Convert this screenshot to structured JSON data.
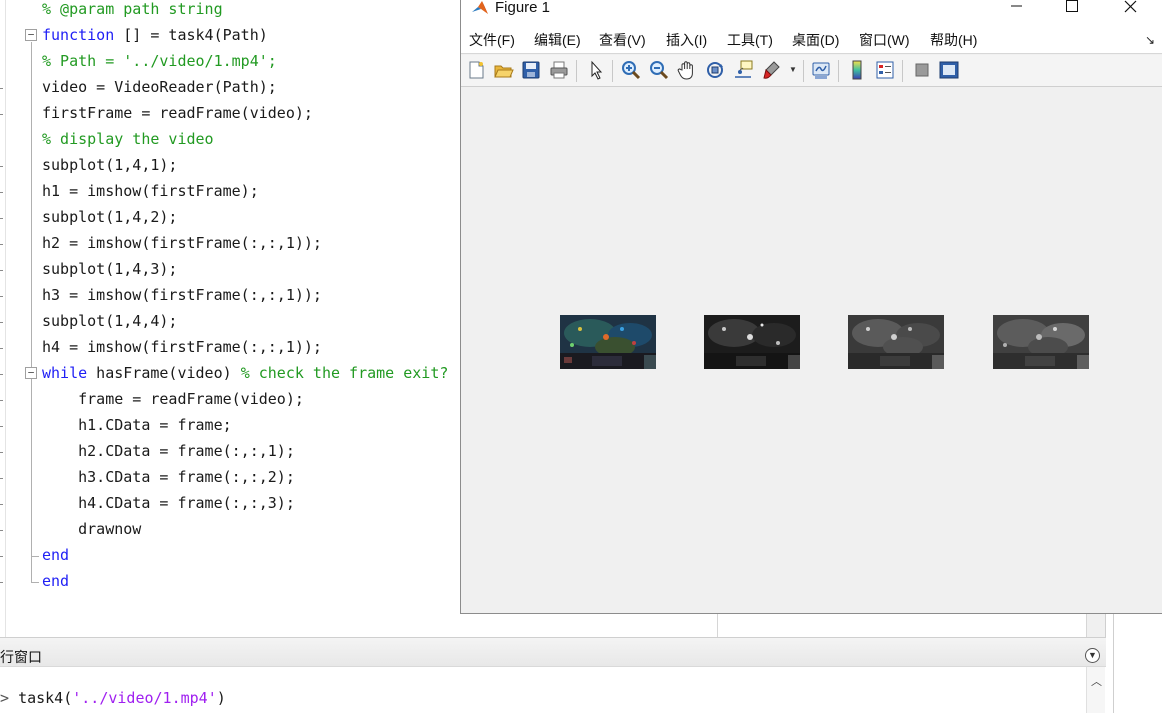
{
  "editor": {
    "lines": [
      {
        "segments": [
          {
            "t": "% @param path string",
            "c": "cm"
          }
        ]
      },
      {
        "segments": [
          {
            "t": "function",
            "c": "kw"
          },
          {
            "t": " [] = task4(Path)",
            "c": ""
          }
        ]
      },
      {
        "segments": [
          {
            "t": "% Path = '../video/1.mp4';",
            "c": "cm"
          }
        ]
      },
      {
        "segments": [
          {
            "t": "video = VideoReader(Path);",
            "c": ""
          }
        ]
      },
      {
        "segments": [
          {
            "t": "firstFrame = readFrame(video);",
            "c": ""
          }
        ]
      },
      {
        "segments": [
          {
            "t": "% display the video",
            "c": "cm"
          }
        ]
      },
      {
        "segments": [
          {
            "t": "subplot(1,4,1);",
            "c": ""
          }
        ]
      },
      {
        "segments": [
          {
            "t": "h1 = imshow(firstFrame);",
            "c": ""
          }
        ]
      },
      {
        "segments": [
          {
            "t": "subplot(1,4,2);",
            "c": ""
          }
        ]
      },
      {
        "segments": [
          {
            "t": "h2 = imshow(firstFrame(:,:,1));",
            "c": ""
          }
        ]
      },
      {
        "segments": [
          {
            "t": "subplot(1,4,3);",
            "c": ""
          }
        ]
      },
      {
        "segments": [
          {
            "t": "h3 = imshow(firstFrame(:,:,1));",
            "c": ""
          }
        ]
      },
      {
        "segments": [
          {
            "t": "subplot(1,4,4);",
            "c": ""
          }
        ]
      },
      {
        "segments": [
          {
            "t": "h4 = imshow(firstFrame(:,:,1));",
            "c": ""
          }
        ]
      },
      {
        "segments": [
          {
            "t": "while",
            "c": "kw"
          },
          {
            "t": " hasFrame(video) ",
            "c": ""
          },
          {
            "t": "% check the frame exit?",
            "c": "cm"
          }
        ]
      },
      {
        "segments": [
          {
            "t": "    frame = readFrame(video);",
            "c": ""
          }
        ]
      },
      {
        "segments": [
          {
            "t": "    h1.CData = frame;",
            "c": ""
          }
        ]
      },
      {
        "segments": [
          {
            "t": "    h2.CData = frame(:,:,1);",
            "c": ""
          }
        ]
      },
      {
        "segments": [
          {
            "t": "    h3.CData = frame(:,:,2);",
            "c": ""
          }
        ]
      },
      {
        "segments": [
          {
            "t": "    h4.CData = frame(:,:,3);",
            "c": ""
          }
        ]
      },
      {
        "segments": [
          {
            "t": "    drawnow",
            "c": ""
          }
        ]
      },
      {
        "segments": [
          {
            "t": "end",
            "c": "kw"
          }
        ]
      },
      {
        "segments": [
          {
            "t": "end",
            "c": "kw"
          }
        ]
      }
    ]
  },
  "command_window": {
    "title": "行窗口",
    "prompt": "> ",
    "command_func": "task4(",
    "command_arg": "'../video/1.mp4'",
    "command_close": ")"
  },
  "figure": {
    "title": "Figure 1",
    "menus": [
      "文件(F)",
      "编辑(E)",
      "查看(V)",
      "插入(I)",
      "工具(T)",
      "桌面(D)",
      "窗口(W)",
      "帮助(H)"
    ],
    "menu_overflow_icon": "dock-arrow-icon",
    "toolbar": [
      "new-figure-icon",
      "open-file-icon",
      "save-icon",
      "print-icon",
      "select-arrow-icon",
      "zoom-in-icon",
      "zoom-out-icon",
      "pan-hand-icon",
      "rotate-3d-icon",
      "data-cursor-icon",
      "brush-icon",
      "link-plot-icon",
      "colorbar-icon",
      "legend-icon",
      "hide-plot-tools-icon",
      "show-plot-tools-icon"
    ],
    "subplots": [
      {
        "name": "subplot-1",
        "kind": "color frame"
      },
      {
        "name": "subplot-2",
        "kind": "red channel"
      },
      {
        "name": "subplot-3",
        "kind": "green channel"
      },
      {
        "name": "subplot-4",
        "kind": "blue channel"
      }
    ]
  },
  "colors": {
    "keyword": "#1f1ff5",
    "comment": "#229a22",
    "string": "#a020f0",
    "figure_background": "#f0f0f0"
  }
}
